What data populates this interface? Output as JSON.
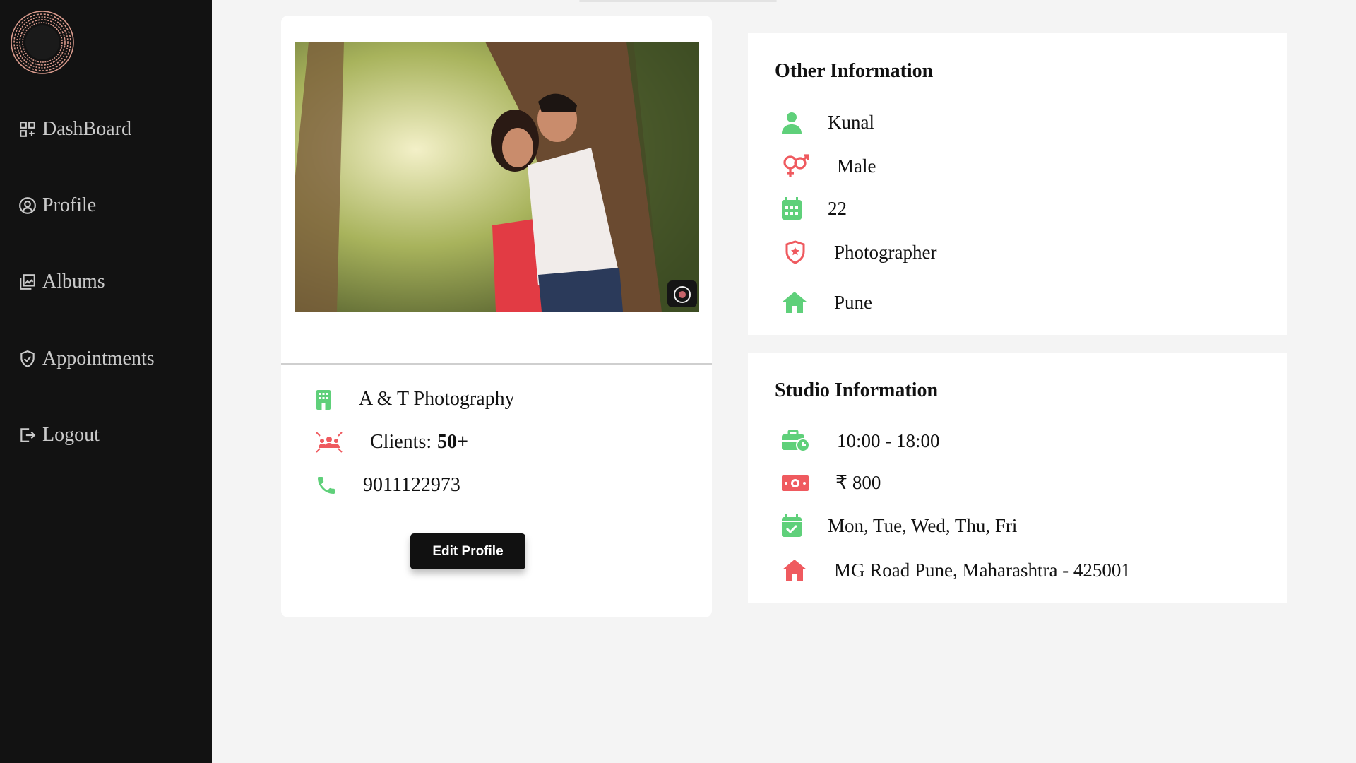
{
  "sidebar": {
    "logo_icon": "spiral-logo",
    "items": [
      {
        "label": "DashBoard",
        "icon": "dashboard-icon"
      },
      {
        "label": "Profile",
        "icon": "user-circle-icon"
      },
      {
        "label": "Albums",
        "icon": "album-icon"
      },
      {
        "label": "Appointments",
        "icon": "shield-check-icon"
      },
      {
        "label": "Logout",
        "icon": "logout-icon"
      }
    ]
  },
  "profile_card": {
    "photo_icon": "camera-icon",
    "studio_name": "A & T Photography",
    "clients_label": "Clients:",
    "clients_value": "50+",
    "phone": "9011122973",
    "edit_button": "Edit Profile"
  },
  "other_info": {
    "title": "Other Information",
    "name": "Kunal",
    "gender": "Male",
    "age": "22",
    "profession": "Photographer",
    "city": "Pune"
  },
  "studio_info": {
    "title": "Studio Information",
    "hours": "10:00 - 18:00",
    "price": "₹ 800",
    "days": "Mon, Tue, Wed, Thu, Fri",
    "address": "MG Road Pune, Maharashtra - 425001"
  },
  "colors": {
    "sidebar_bg": "#121212",
    "accent_green": "#5fd07a",
    "accent_red": "#ef5a5f",
    "button_bg": "#111111"
  }
}
